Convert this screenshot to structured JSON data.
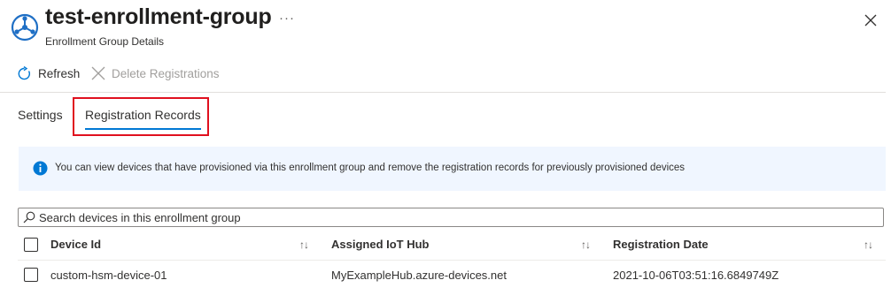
{
  "header": {
    "title": "test-enrollment-group",
    "subtitle": "Enrollment Group Details",
    "more_label": "···"
  },
  "toolbar": {
    "refresh_label": "Refresh",
    "delete_label": "Delete Registrations"
  },
  "tabs": [
    {
      "label": "Settings",
      "selected": false
    },
    {
      "label": "Registration Records",
      "selected": true
    }
  ],
  "info": {
    "text": "You can view devices that have provisioned via this enrollment group  and remove the registration records for previously provisioned devices"
  },
  "search": {
    "placeholder": "Search devices in this enrollment group",
    "value": ""
  },
  "table": {
    "columns": [
      {
        "label": "Device Id",
        "sort_icon": "↑↓"
      },
      {
        "label": "Assigned IoT Hub",
        "sort_icon": "↑↓"
      },
      {
        "label": "Registration Date",
        "sort_icon": "↑↓"
      }
    ],
    "rows": [
      {
        "device_id": "custom-hsm-device-01",
        "hub": "MyExampleHub.azure-devices.net",
        "date": "2021-10-06T03:51:16.6849749Z"
      }
    ]
  },
  "colors": {
    "accent": "#0078d4",
    "highlight": "#e0101e",
    "info_background": "#f0f6ff"
  },
  "icons": {
    "title": "enrollment-group-icon",
    "more": "more-icon",
    "close": "close-icon",
    "refresh": "refresh-icon",
    "delete": "delete-icon",
    "info": "info-icon",
    "search": "search-icon"
  }
}
